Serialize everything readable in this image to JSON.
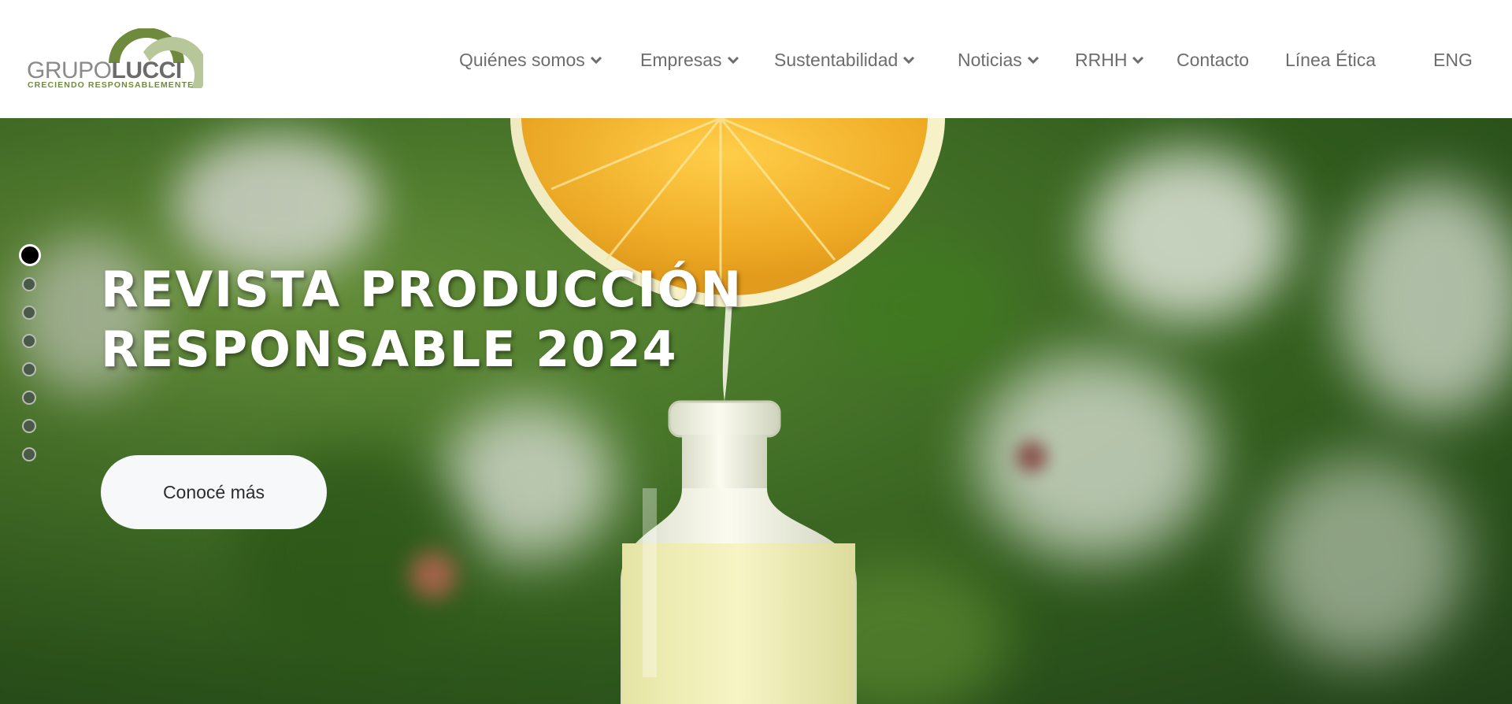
{
  "logo": {
    "grupo": "GRUPO",
    "lucci": "LUCCI",
    "tagline": "CRECIENDO RESPONSABLEMENTE",
    "colors": {
      "arc_dark": "#6f8a3d",
      "arc_light": "#b7c79a",
      "text": "#7a7a7a",
      "tagline": "#6e8c3c"
    }
  },
  "nav": {
    "items": [
      {
        "label": "Quiénes somos",
        "dropdown": true
      },
      {
        "label": "Empresas",
        "dropdown": true
      },
      {
        "label": "Sustentabilidad",
        "dropdown": true
      },
      {
        "label": "Noticias",
        "dropdown": true
      },
      {
        "label": "RRHH",
        "dropdown": true
      },
      {
        "label": "Contacto",
        "dropdown": false
      },
      {
        "label": "Línea Ética",
        "dropdown": false
      }
    ],
    "language": "ENG",
    "chevron_icon": "chevron-down-icon"
  },
  "hero": {
    "title_line1": "REVISTA PRODUCCIÓN",
    "title_line2": "RESPONSABLE 2024",
    "cta_label": "Conocé más",
    "slider": {
      "total": 8,
      "active": 1
    },
    "image": "lemon-half-dripping-juice-into-glass-bottle-over-blurred-green-foliage"
  }
}
